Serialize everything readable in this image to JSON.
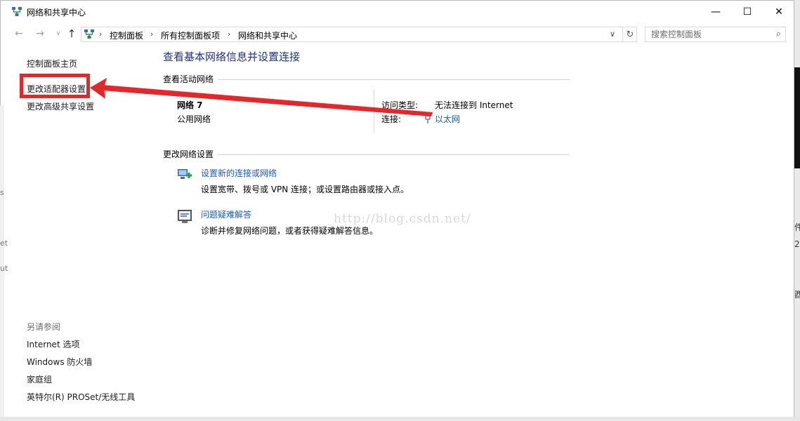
{
  "window": {
    "title": "网络和共享中心",
    "controls": {
      "minimize": "—",
      "maximize": "☐",
      "close": "✕"
    }
  },
  "navigation": {
    "back": "←",
    "forward": "→",
    "recent": "∨",
    "up": "↑",
    "breadcrumb": [
      "控制面板",
      "所有控制面板项",
      "网络和共享中心"
    ],
    "breadcrumb_separator": "›",
    "dropdown": "∨",
    "refresh": "↻",
    "search_placeholder": "搜索控制面板",
    "search_icon": "⌕"
  },
  "left_pane": {
    "links": [
      "控制面板主页",
      "更改适配器设置",
      "更改高级共享设置"
    ],
    "see_also_title": "另请参阅",
    "see_also": [
      "Internet 选项",
      "Windows 防火墙",
      "家庭组",
      "英特尔(R) PROSet/无线工具"
    ]
  },
  "main": {
    "title": "查看基本网络信息并设置连接",
    "active_networks_title": "查看活动网络",
    "network": {
      "name": "网络  7",
      "category": "公用网络",
      "access_type_label": "访问类型:",
      "access_type_value": "无法连接到 Internet",
      "connections_label": "连接:",
      "connection_link": "以太网"
    },
    "change_settings_title": "更改网络设置",
    "tasks": [
      {
        "icon": "network-setup-icon",
        "link": "设置新的连接或网络",
        "desc": "设置宽带、拨号或 VPN 连接；或设置路由器或接入点。"
      },
      {
        "icon": "troubleshoot-icon",
        "link": "问题疑难解答",
        "desc": "诊断并修复网络问题，或者获得疑难解答信息。"
      }
    ]
  },
  "watermark": "http://blog.csdn.net/",
  "annotation": {
    "color": "#e3272b"
  },
  "edge_fragments": {
    "right": [
      "件",
      "2.",
      "酉"
    ],
    "left": [
      "s",
      "et",
      "ut"
    ]
  }
}
